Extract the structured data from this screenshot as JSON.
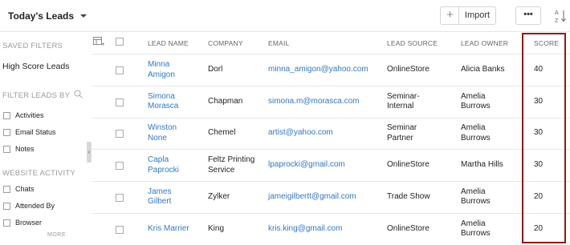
{
  "header": {
    "view_title": "Today's Leads",
    "plus_label": "+",
    "import_label": "Import",
    "more_label": "•••"
  },
  "sidebar": {
    "saved_filters_heading": "SAVED FILTERS",
    "saved_filter": "High Score Leads",
    "filter_leads_heading": "FILTER LEADS BY",
    "filters": [
      "Activities",
      "Email Status",
      "Notes"
    ],
    "website_activity_heading": "WEBSITE ACTIVITY",
    "website_filters": [
      "Chats",
      "Attended By",
      "Browser"
    ],
    "more_label": "MORE"
  },
  "table": {
    "columns": [
      "LEAD NAME",
      "COMPANY",
      "EMAIL",
      "LEAD SOURCE",
      "LEAD OWNER",
      "SCORE"
    ],
    "rows": [
      {
        "name": [
          "Minna",
          "Amigon"
        ],
        "company": [
          "Dorl"
        ],
        "email": "minna_amigon@yahoo.com",
        "source": [
          "OnlineStore"
        ],
        "owner": [
          "Alicia Banks"
        ],
        "score": "40"
      },
      {
        "name": [
          "Simona",
          "Morasca"
        ],
        "company": [
          "Chapman"
        ],
        "email": "simona.m@morasca.com",
        "source": [
          "Seminar-",
          "Internal"
        ],
        "owner": [
          "Amelia",
          "Burrows"
        ],
        "score": "30"
      },
      {
        "name": [
          "Winston",
          "None"
        ],
        "company": [
          "Chemel"
        ],
        "email": "artist@yahoo.com",
        "source": [
          "Seminar",
          "Partner"
        ],
        "owner": [
          "Amelia",
          "Burrows"
        ],
        "score": "30"
      },
      {
        "name": [
          "Capla",
          "Paprocki"
        ],
        "company": [
          "Feltz Printing",
          "Service"
        ],
        "email": "lpaprocki@gmail.com",
        "source": [
          "OnlineStore"
        ],
        "owner": [
          "Martha Hills"
        ],
        "score": "30"
      },
      {
        "name": [
          "James",
          "Gilbert"
        ],
        "company": [
          "Zylker"
        ],
        "email": "jameigilbertt@gmail.com",
        "source": [
          "Trade Show"
        ],
        "owner": [
          "Amelia",
          "Burrows"
        ],
        "score": "20"
      },
      {
        "name": [
          "Kris Marrier"
        ],
        "company": [
          "King"
        ],
        "email": "kris.king@gmail.com",
        "source": [
          "OnlineStore"
        ],
        "owner": [
          "Amelia",
          "Burrows"
        ],
        "score": "20"
      }
    ]
  },
  "colors": {
    "link": "#2f78c4",
    "highlight": "#8b1a1a"
  }
}
